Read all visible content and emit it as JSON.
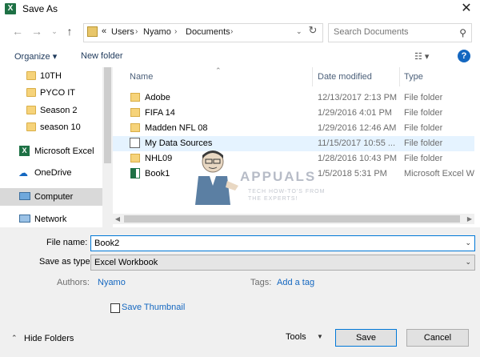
{
  "window": {
    "title": "Save As",
    "app_icon": "excel-icon",
    "close_glyph": "✕"
  },
  "nav": {
    "breadcrumb_prefix": "«",
    "breadcrumbs": [
      "Users",
      "Nyamo",
      "Documents"
    ],
    "search_placeholder": "Search Documents"
  },
  "toolbar": {
    "organize_label": "Organize ▾",
    "new_folder_label": "New folder",
    "help_glyph": "?"
  },
  "sidebar": {
    "items": [
      {
        "label": "10TH",
        "icon": "folder-icon"
      },
      {
        "label": "PYCO IT",
        "icon": "folder-icon"
      },
      {
        "label": "Season 2",
        "icon": "folder-icon"
      },
      {
        "label": "season 10",
        "icon": "folder-icon"
      },
      {
        "label": "Microsoft Excel",
        "icon": "excel-icon"
      },
      {
        "label": "OneDrive",
        "icon": "cloud-icon"
      },
      {
        "label": "Computer",
        "icon": "computer-icon"
      },
      {
        "label": "Network",
        "icon": "network-icon"
      }
    ]
  },
  "files": {
    "columns": {
      "name": "Name",
      "date": "Date modified",
      "type": "Type"
    },
    "rows": [
      {
        "name": "Adobe",
        "date": "12/13/2017 2:13 PM",
        "type": "File folder",
        "icon": "folder-icon"
      },
      {
        "name": "FIFA 14",
        "date": "1/29/2016 4:01 PM",
        "type": "File folder",
        "icon": "folder-icon"
      },
      {
        "name": "Madden NFL 08",
        "date": "1/29/2016 12:46 AM",
        "type": "File folder",
        "icon": "folder-icon"
      },
      {
        "name": "My Data Sources",
        "date": "11/15/2017 10:55 ...",
        "type": "File folder",
        "icon": "data-sources-icon"
      },
      {
        "name": "NHL09",
        "date": "1/28/2016 10:43 PM",
        "type": "File folder",
        "icon": "folder-icon"
      },
      {
        "name": "Book1",
        "date": "1/5/2018 5:31 PM",
        "type": "Microsoft Excel W...",
        "icon": "excel-file-icon"
      }
    ]
  },
  "watermark": {
    "brand": "APPUALS",
    "tagline_1": "TECH HOW-TO'S FROM",
    "tagline_2": "THE EXPERTS!"
  },
  "form": {
    "file_name_label": "File name:",
    "file_name_value": "Book2",
    "save_type_label": "Save as type:",
    "save_type_value": "Excel Workbook",
    "authors_label": "Authors:",
    "authors_value": "Nyamo",
    "tags_label": "Tags:",
    "tags_value": "Add a tag",
    "thumbnail_label": "Save Thumbnail"
  },
  "footer": {
    "hide_folders_label": "Hide Folders",
    "tools_label": "Tools",
    "save_label": "Save",
    "cancel_label": "Cancel"
  },
  "colors": {
    "accent": "#0078d7",
    "excel_green": "#1e7145",
    "selection": "#e5f3ff",
    "link": "#1467c0"
  }
}
